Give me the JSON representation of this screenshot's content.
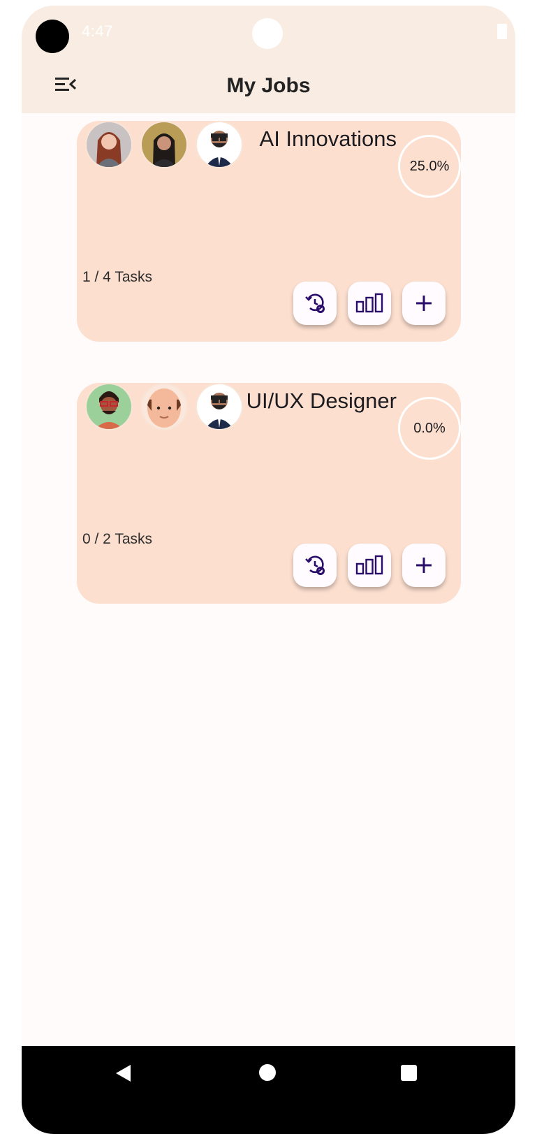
{
  "status_bar": {
    "time": "4:47"
  },
  "appbar": {
    "title": "My Jobs",
    "menu_icon": "menu-collapse-icon"
  },
  "jobs": [
    {
      "name": "AI Innovations",
      "progress": "25.0%",
      "tasks": "1 / 4 Tasks",
      "members": [
        "woman-red-hair-avatar",
        "woman-dark-hair-avatar",
        "bearded-man-suit-avatar"
      ]
    },
    {
      "name": "UI/UX Designer",
      "progress": "0.0%",
      "tasks": "0 / 2 Tasks",
      "members": [
        "man-glasses-green-avatar",
        "bald-man-avatar",
        "bearded-man-suit-avatar"
      ]
    }
  ],
  "card_actions": [
    "history-settings-icon",
    "bar-chart-icon",
    "add-icon"
  ],
  "colors": {
    "appbar_bg": "#f9ede3",
    "card_bg": "#fcdfcf",
    "icon_color": "#2a0d6b",
    "page_bg": "#fffbfa"
  }
}
